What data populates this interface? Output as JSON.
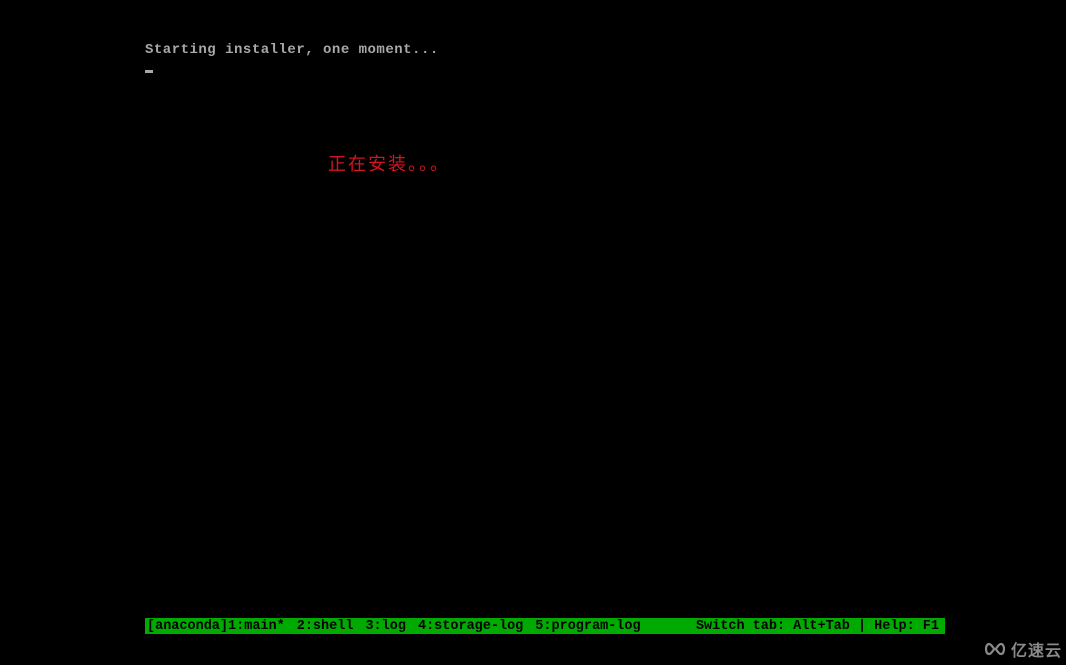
{
  "terminal": {
    "line1": "Starting installer, one moment..."
  },
  "annotation": {
    "text": "正在安装。。。"
  },
  "status_bar": {
    "session": "[anaconda]",
    "tabs": [
      "1:main*",
      "2:shell",
      "3:log",
      "4:storage-log",
      "5:program-log"
    ],
    "help_text": "Switch tab: Alt+Tab | Help: F1"
  },
  "watermark": {
    "text": "亿速云"
  }
}
